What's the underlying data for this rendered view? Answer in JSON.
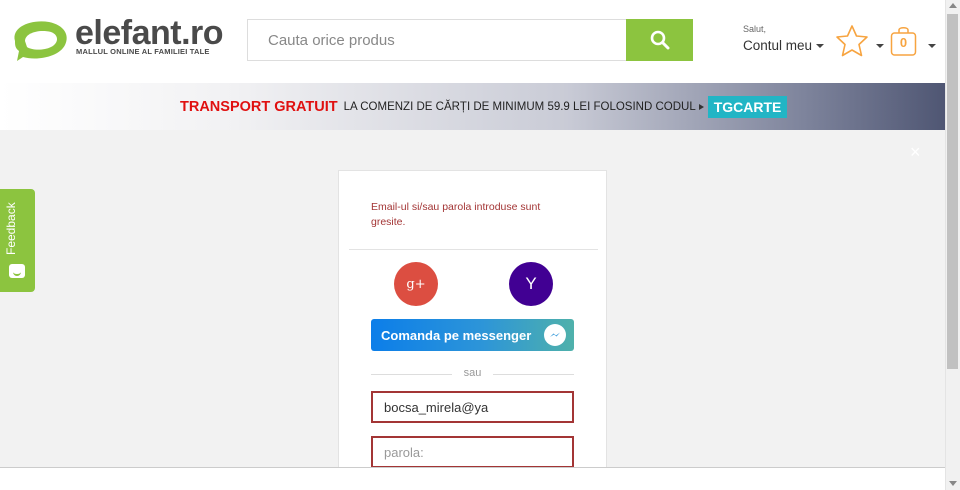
{
  "header": {
    "logo": {
      "name": "elefant.ro",
      "tagline": "MALLUL ONLINE AL FAMILIEI TALE"
    },
    "search": {
      "placeholder": "Cauta orice produs"
    },
    "account": {
      "greeting": "Salut,",
      "label": "Contul meu"
    },
    "cart": {
      "count": "0"
    }
  },
  "banner": {
    "highlight": "TRANSPORT GRATUIT",
    "text": "LA COMENZI DE CĂRȚI DE MINIMUM 59.9 LEI FOLOSIND CODUL",
    "code": "TGCARTE"
  },
  "feedback": {
    "label": "Feedback"
  },
  "login": {
    "error": "Email-ul si/sau parola introduse sunt gresite.",
    "google_glyph": "g+",
    "yahoo_glyph": "Y",
    "messenger_label": "Comanda pe messenger",
    "separator": "sau",
    "email_value": "bocsa_mirela@ya",
    "password_placeholder": "parola:"
  },
  "colors": {
    "brand_green": "#8cc43f",
    "banner_red": "#e01010",
    "code_teal": "#22b5c5",
    "error_red": "#a33535",
    "google_red": "#dc4e41",
    "yahoo_purple": "#410093"
  }
}
